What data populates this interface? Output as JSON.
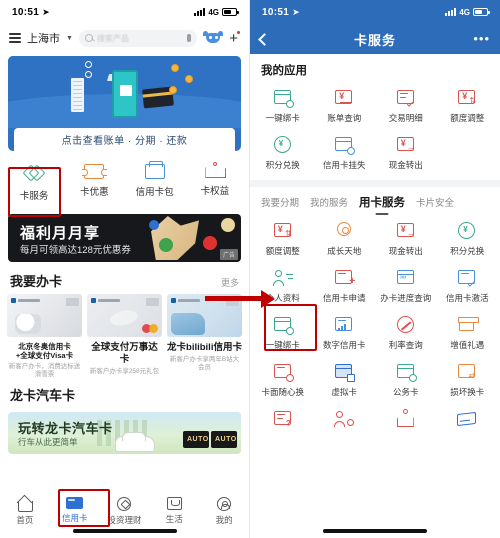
{
  "left_phone": {
    "status": {
      "time": "10:51",
      "location_icon": "location-arrow-icon",
      "network": "4G",
      "signal_icon": "signal-bars-icon",
      "battery_icon": "battery-icon"
    },
    "topnav": {
      "menu_icon": "hamburger-menu-icon",
      "city": "上海市",
      "caret": "▼",
      "search_placeholder": "搜索产品",
      "search_icon": "search-icon",
      "mic_icon": "microphone-icon",
      "mascot_icon": "mascot-icon",
      "add_icon": "plus-icon"
    },
    "hero": {
      "cta": "点击查看账单 · 分期 · 还款"
    },
    "quick_items": [
      {
        "label": "卡服务",
        "icon": "card-service-icon",
        "color": "#3aa98d",
        "highlighted": true
      },
      {
        "label": "卡优惠",
        "icon": "ticket-icon",
        "color": "#e8893f",
        "highlighted": false
      },
      {
        "label": "信用卡包",
        "icon": "wallet-icon",
        "color": "#4a90d9",
        "highlighted": false
      },
      {
        "label": "卡权益",
        "icon": "crown-icon",
        "color": "#d9534f",
        "highlighted": false
      }
    ],
    "promo": {
      "title": "福利月月享",
      "subtitle": "每月可领高达128元优惠券",
      "tag": "广告"
    },
    "apply_section": {
      "heading": "我要办卡",
      "more": "更多",
      "cards": [
        {
          "title": "北京冬奥信用卡\n+全球支付Visa卡",
          "subtitle": "新客户办卡，消费达标送滑雪票"
        },
        {
          "title": "全球支付万事达卡",
          "subtitle": "新客户办卡享258元礼包"
        },
        {
          "title": "龙卡bilibili信用卡",
          "subtitle": "新客户办卡享两年B站大会员"
        }
      ]
    },
    "auto_section": {
      "heading": "龙卡汽车卡",
      "banner_title": "玩转龙卡汽车卡",
      "banner_subtitle": "行车从此更简单",
      "card_badge": "AUTO"
    },
    "tabbar": [
      {
        "label": "首页",
        "icon": "home-icon",
        "active": false
      },
      {
        "label": "信用卡",
        "icon": "credit-card-icon",
        "active": true,
        "highlighted": true
      },
      {
        "label": "投资理财",
        "icon": "finance-icon",
        "active": false
      },
      {
        "label": "生活",
        "icon": "life-icon",
        "active": false
      },
      {
        "label": "我的",
        "icon": "profile-icon",
        "active": false
      }
    ]
  },
  "right_phone": {
    "status": {
      "time": "10:51",
      "location_icon": "location-arrow-icon",
      "network": "4G",
      "signal_icon": "signal-bars-icon",
      "battery_icon": "battery-icon"
    },
    "nav": {
      "back_icon": "back-chevron-icon",
      "title": "卡服务",
      "more_icon": "more-dots-icon"
    },
    "my_apps": {
      "heading": "我的应用",
      "items": [
        {
          "label": "一键绑卡",
          "icon": "bind-card-icon",
          "color": "#3aa98d"
        },
        {
          "label": "账单查询",
          "icon": "bill-query-icon",
          "color": "#d9534f"
        },
        {
          "label": "交易明细",
          "icon": "transaction-detail-icon",
          "color": "#d9534f"
        },
        {
          "label": "额度调整",
          "icon": "credit-limit-icon",
          "color": "#d9534f"
        },
        {
          "label": "积分兑换",
          "icon": "points-exchange-icon",
          "color": "#3aa98d"
        },
        {
          "label": "信用卡挂失",
          "icon": "report-loss-icon",
          "color": "#4a90d9"
        },
        {
          "label": "现金转出",
          "icon": "cash-transfer-icon",
          "color": "#d9534f"
        }
      ]
    },
    "tabs": [
      {
        "label": "我要分期",
        "active": false
      },
      {
        "label": "我的服务",
        "active": false
      },
      {
        "label": "用卡服务",
        "active": true
      },
      {
        "label": "卡片安全",
        "active": false
      }
    ],
    "service_items": [
      {
        "label": "额度调整",
        "icon": "credit-limit-icon",
        "color": "#d9534f",
        "highlighted": false
      },
      {
        "label": "成长天地",
        "icon": "growth-medal-icon",
        "color": "#e8893f",
        "highlighted": false
      },
      {
        "label": "现金转出",
        "icon": "cash-transfer-icon",
        "color": "#d9534f",
        "highlighted": false
      },
      {
        "label": "积分兑换",
        "icon": "points-exchange-icon",
        "color": "#3aa98d",
        "highlighted": false
      },
      {
        "label": "个人资料",
        "icon": "personal-info-icon",
        "color": "#3aa98d",
        "highlighted": true
      },
      {
        "label": "信用卡申请",
        "icon": "card-apply-icon",
        "color": "#d9534f",
        "highlighted": false
      },
      {
        "label": "办卡进度查询",
        "icon": "apply-progress-icon",
        "color": "#4a90d9",
        "highlighted": false
      },
      {
        "label": "信用卡激活",
        "icon": "card-activate-icon",
        "color": "#4a90d9",
        "highlighted": false
      },
      {
        "label": "一键绑卡",
        "icon": "bind-card-icon",
        "color": "#3aa98d",
        "highlighted": false
      },
      {
        "label": "数字信用卡",
        "icon": "digital-card-icon",
        "color": "#4a90d9",
        "highlighted": false
      },
      {
        "label": "利率查询",
        "icon": "rate-query-icon",
        "color": "#d9534f",
        "highlighted": false
      },
      {
        "label": "增值礼遇",
        "icon": "gift-icon",
        "color": "#e8893f",
        "highlighted": false
      },
      {
        "label": "卡面随心换",
        "icon": "card-face-change-icon",
        "color": "#d9534f",
        "highlighted": false
      },
      {
        "label": "虚拟卡",
        "icon": "virtual-card-icon",
        "color": "#2f6fd0",
        "highlighted": false
      },
      {
        "label": "公务卡",
        "icon": "official-card-icon",
        "color": "#3aa98d",
        "highlighted": false
      },
      {
        "label": "损坏换卡",
        "icon": "damaged-card-replace-icon",
        "color": "#e8893f",
        "highlighted": false
      }
    ],
    "partial_row": [
      {
        "label": "",
        "icon": "question-doc-icon",
        "color": "#d9534f"
      },
      {
        "label": "",
        "icon": "account-person-icon",
        "color": "#d9534f"
      },
      {
        "label": "",
        "icon": "crown-icon",
        "color": "#d9534f"
      },
      {
        "label": "",
        "icon": "wallet-icon",
        "color": "#2f6fd0"
      }
    ]
  },
  "annotations": {
    "highlight_color": "#c00000",
    "arrow": "right-arrow",
    "boxes": [
      "卡服务",
      "信用卡",
      "个人资料"
    ]
  }
}
